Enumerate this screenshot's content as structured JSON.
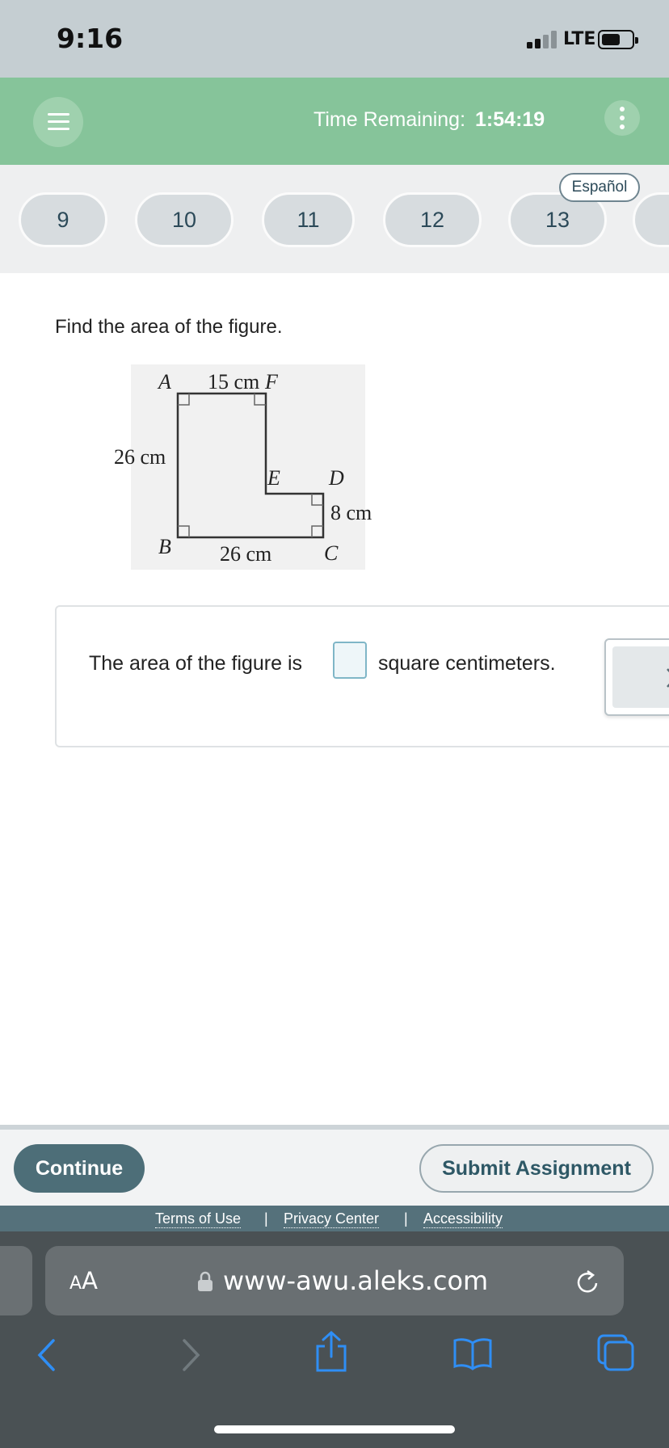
{
  "status_bar": {
    "time": "9:16",
    "network": "LTE",
    "icons": [
      "signal-icon",
      "battery-icon"
    ]
  },
  "header": {
    "timer_label": "Time Remaining:",
    "timer_value": "1:54:19",
    "icons": [
      "hamburger-menu-icon",
      "kebab-menu-icon"
    ],
    "bg_color": "#86c49a"
  },
  "question_nav": {
    "items": [
      "9",
      "10",
      "11",
      "12",
      "13"
    ],
    "language_label": "Español"
  },
  "question": {
    "prompt": "Find the area of the figure.",
    "figure": {
      "vertex_labels": [
        "A",
        "F",
        "E",
        "D",
        "C",
        "B"
      ],
      "top_label": "15 cm",
      "left_label": "26 cm",
      "bottom_label": "26 cm",
      "right_label": "8 cm"
    },
    "answer_prefix": "The area of the figure is",
    "answer_value": "",
    "answer_suffix": "square centimeters."
  },
  "footer": {
    "continue_label": "Continue",
    "submit_label": "Submit Assignment",
    "links": [
      "Terms of Use",
      "Privacy Center",
      "Accessibility"
    ],
    "separator": "|"
  },
  "browser": {
    "text_size_label_small": "A",
    "text_size_label_large": "A",
    "url": "www-awu.aleks.com",
    "icons": [
      "lock-icon",
      "reload-icon",
      "back-icon",
      "forward-icon",
      "share-icon",
      "bookmarks-icon",
      "tabs-icon"
    ]
  }
}
